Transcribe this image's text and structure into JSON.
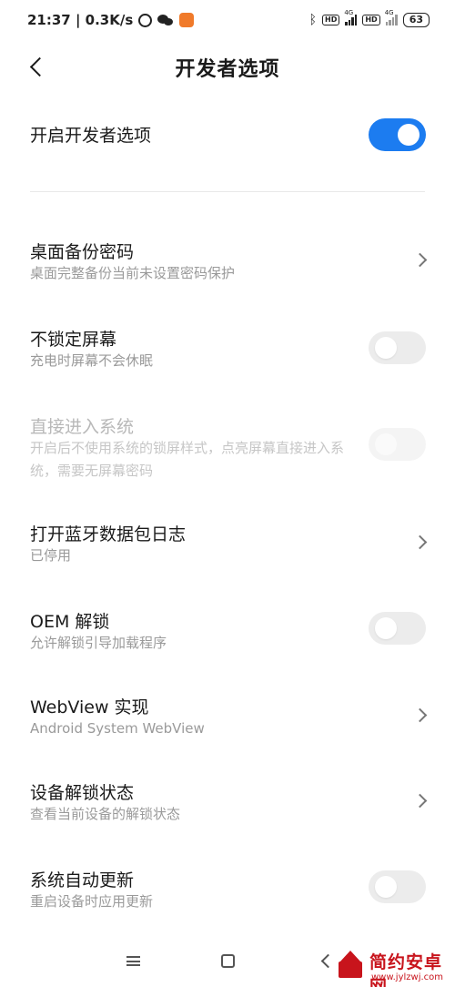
{
  "status_bar": {
    "time_speed": "21:37 | 0.3K/s",
    "hd1": "HD",
    "net1": "4G",
    "hd2": "HD",
    "net2": "4G",
    "battery": "63"
  },
  "header": {
    "title": "开发者选项"
  },
  "master_toggle": {
    "label": "开启开发者选项",
    "state": "on"
  },
  "items": [
    {
      "title": "桌面备份密码",
      "subtitle": "桌面完整备份当前未设置密码保护",
      "control": "chevron"
    },
    {
      "title": "不锁定屏幕",
      "subtitle": "充电时屏幕不会休眠",
      "control": "toggle-off"
    },
    {
      "title": "直接进入系统",
      "subtitle": "开启后不使用系统的锁屏样式，点亮屏幕直接进入系统，需要无屏幕密码",
      "control": "toggle-disabled"
    },
    {
      "title": "打开蓝牙数据包日志",
      "subtitle": "已停用",
      "control": "chevron"
    },
    {
      "title": "OEM 解锁",
      "subtitle": "允许解锁引导加载程序",
      "control": "toggle-off"
    },
    {
      "title": "WebView 实现",
      "subtitle": "Android System WebView",
      "control": "chevron"
    },
    {
      "title": "设备解锁状态",
      "subtitle": "查看当前设备的解锁状态",
      "control": "chevron"
    },
    {
      "title": "系统自动更新",
      "subtitle": "重启设备时应用更新",
      "control": "toggle-off"
    }
  ],
  "watermark": {
    "brand": "简约安卓网",
    "url": "www.jylzwj.com"
  },
  "colors": {
    "accent": "#1c7cf0",
    "watermark": "#c8141c"
  }
}
